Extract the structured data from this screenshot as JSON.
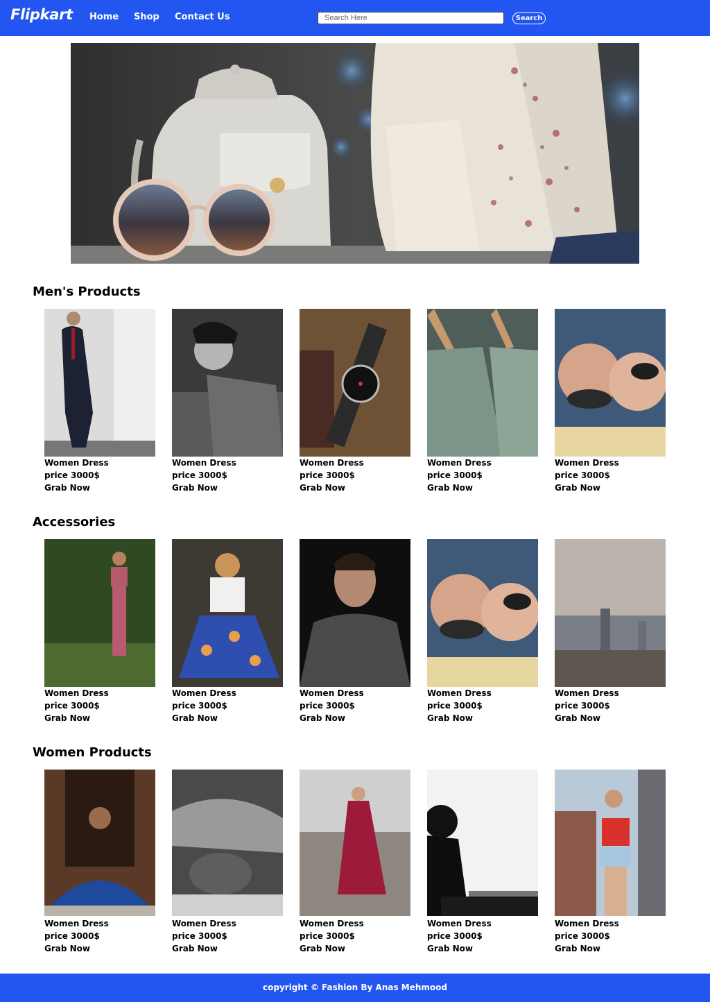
{
  "nav": {
    "brand": "Flipkart",
    "links": [
      "Home",
      "Shop",
      "Contact Us"
    ],
    "search_placeholder": "Search Here",
    "search_button": "Search"
  },
  "sections": [
    {
      "title": "Men's Products",
      "products": [
        {
          "name": "Women Dress",
          "price": "price 3000$",
          "cta": "Grab Now"
        },
        {
          "name": "Women Dress",
          "price": "price 3000$",
          "cta": "Grab Now"
        },
        {
          "name": "Women Dress",
          "price": "price 3000$",
          "cta": "Grab Now"
        },
        {
          "name": "Women Dress",
          "price": "price 3000$",
          "cta": "Grab Now"
        },
        {
          "name": "Women Dress",
          "price": "price 3000$",
          "cta": "Grab Now"
        }
      ]
    },
    {
      "title": "Accessories",
      "products": [
        {
          "name": "Women Dress",
          "price": "price 3000$",
          "cta": "Grab Now"
        },
        {
          "name": "Women Dress",
          "price": "price 3000$",
          "cta": "Grab Now"
        },
        {
          "name": "Women Dress",
          "price": "price 3000$",
          "cta": "Grab Now"
        },
        {
          "name": "Women Dress",
          "price": "price 3000$",
          "cta": "Grab Now"
        },
        {
          "name": "Women Dress",
          "price": "price 3000$",
          "cta": "Grab Now"
        }
      ]
    },
    {
      "title": "Women Products",
      "products": [
        {
          "name": "Women Dress",
          "price": "price 3000$",
          "cta": "Grab Now"
        },
        {
          "name": "Women Dress",
          "price": "price 3000$",
          "cta": "Grab Now"
        },
        {
          "name": "Women Dress",
          "price": "price 3000$",
          "cta": "Grab Now"
        },
        {
          "name": "Women Dress",
          "price": "price 3000$",
          "cta": "Grab Now"
        },
        {
          "name": "Women Dress",
          "price": "price 3000$",
          "cta": "Grab Now"
        }
      ]
    }
  ],
  "footer": {
    "text": "copyright © Fashion By Anas Mehmood"
  },
  "colors": {
    "brand_blue": "#2356f0",
    "background": "#ffffff",
    "text": "#000000"
  }
}
